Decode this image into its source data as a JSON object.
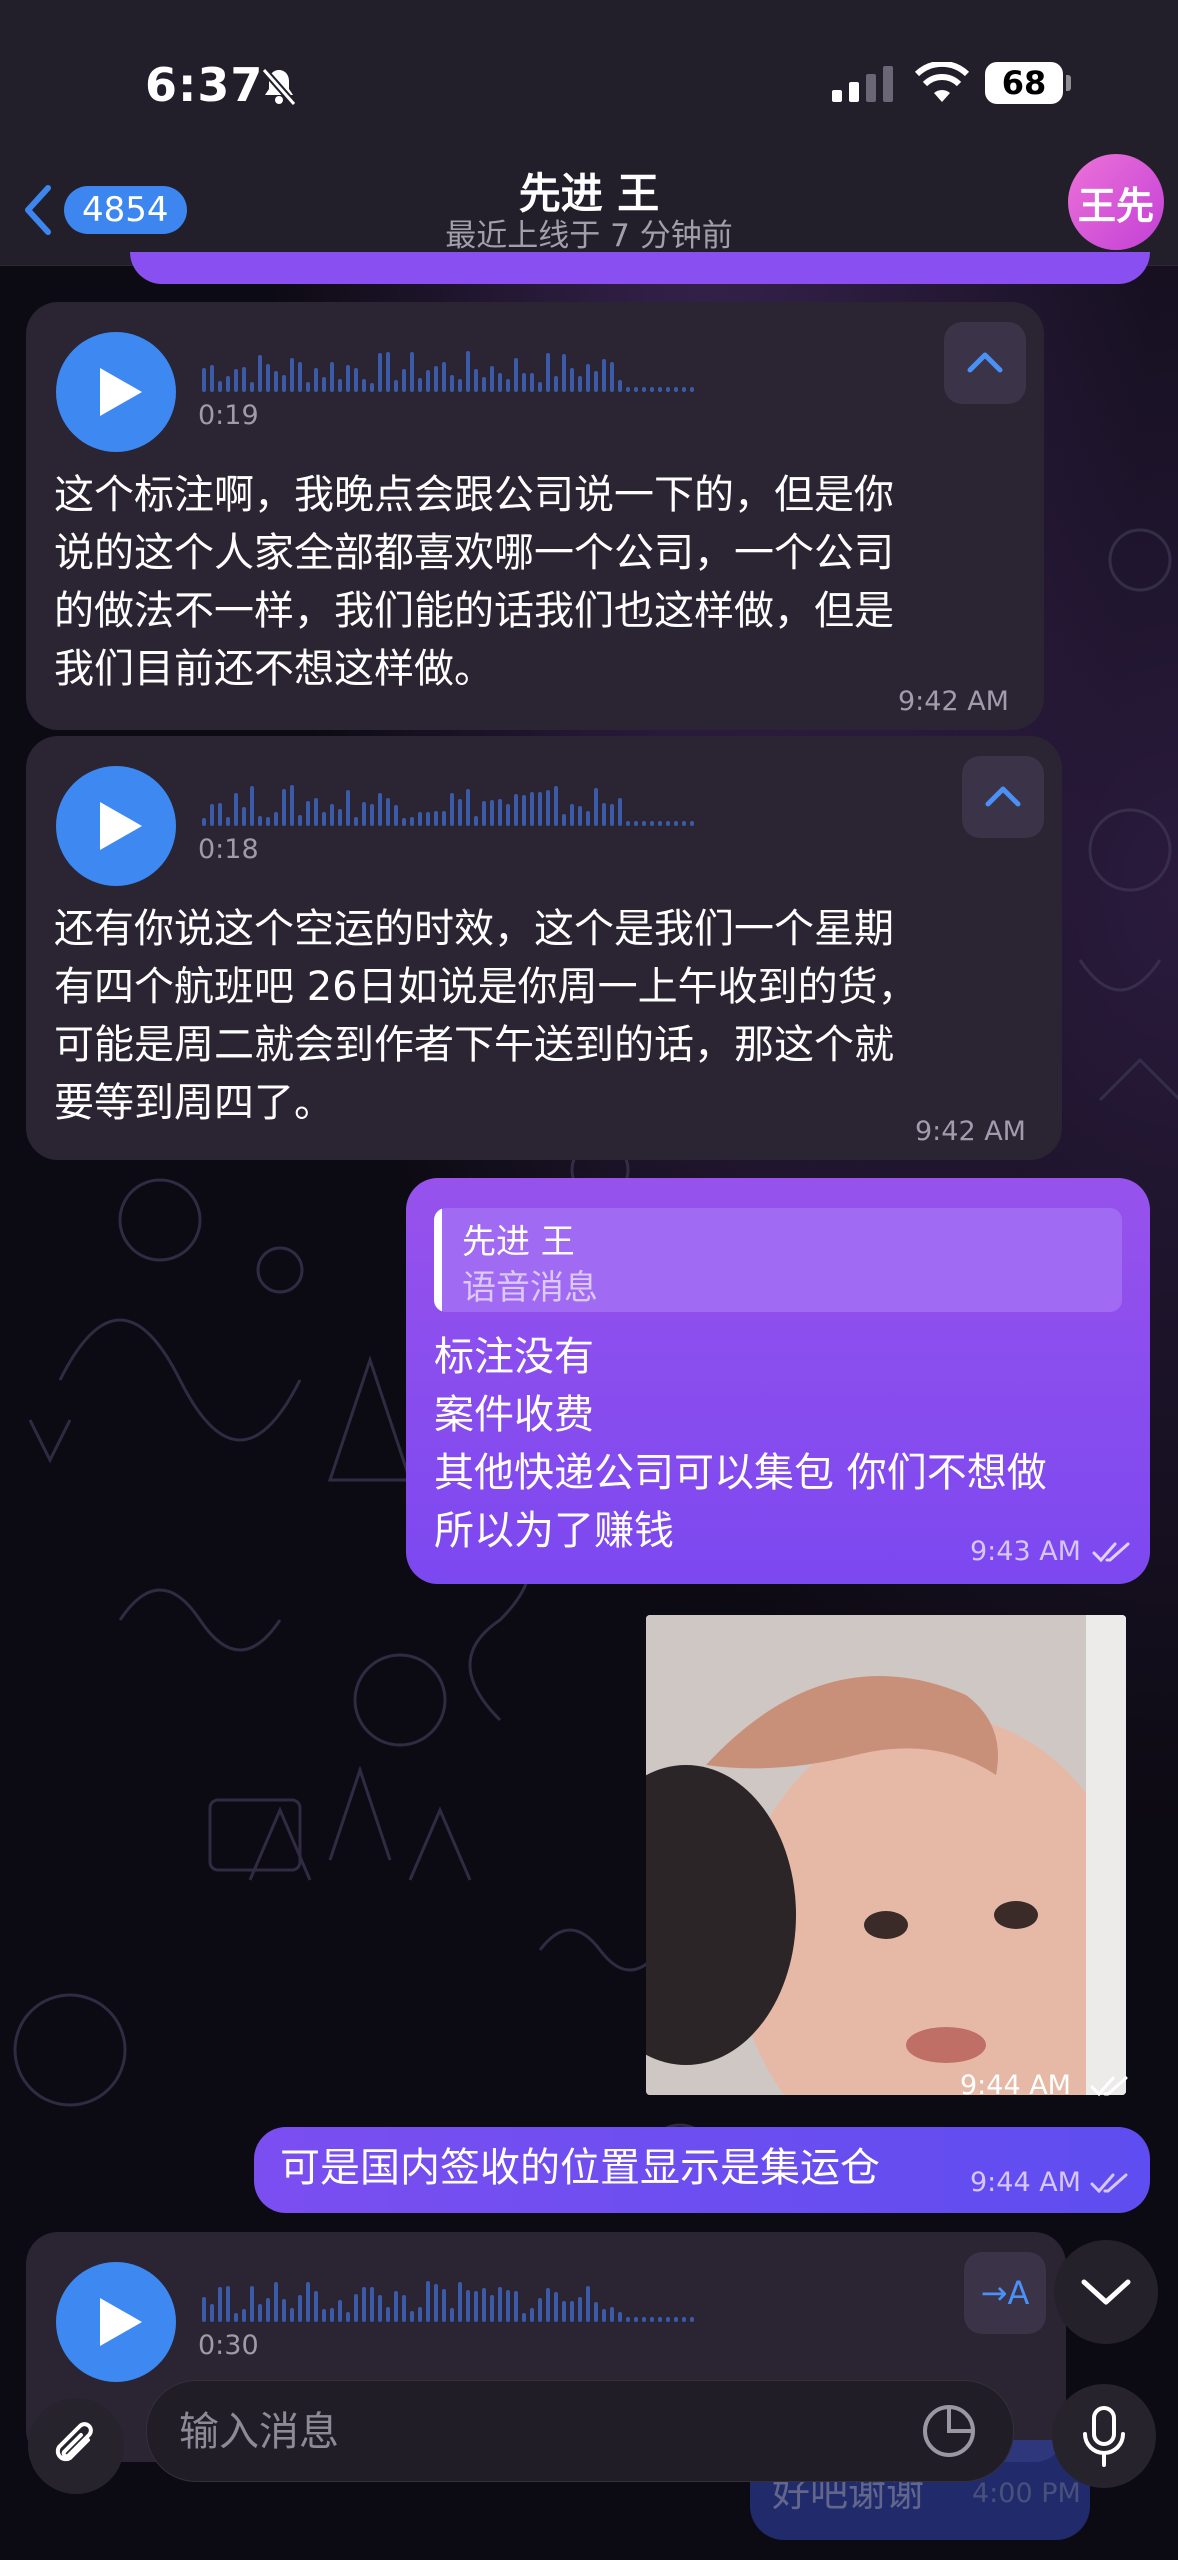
{
  "status": {
    "time": "6:37",
    "battery": "68"
  },
  "header": {
    "back_count": "4854",
    "title": "先进 王",
    "subtitle": "最近上线于 7 分钟前",
    "avatar": "王先"
  },
  "messages": [
    {
      "type": "voice",
      "duration": "0:19",
      "text": "这个标注啊，我晚点会跟公司说一下的，但是你\n说的这个人家全部都喜欢哪一个公司，一个公司\n的做法不一样，我们能的话我们也这样做，但是\n我们目前还不想这样做。",
      "time": "9:42 AM"
    },
    {
      "type": "voice",
      "duration": "0:18",
      "text": "还有你说这个空运的时效，这个是我们一个星期\n有四个航班吧 26日如说是你周一上午收到的货，\n可能是周二就会到作者下午送到的话，那这个就\n要等到周四了。",
      "time": "9:42 AM"
    },
    {
      "type": "reply",
      "reply_name": "先进 王",
      "reply_type": "语音消息",
      "text": "标注没有\n案件收费\n其他快递公司可以集包 你们不想做\n所以为了赚钱",
      "time": "9:43 AM"
    },
    {
      "type": "sticker",
      "time": "9:44 AM"
    },
    {
      "type": "text",
      "text": "可是国内签收的位置显示是集运仓",
      "time": "9:44 AM"
    },
    {
      "type": "voice",
      "duration": "0:30",
      "translate": "→A"
    }
  ],
  "composer": {
    "placeholder": "输入消息"
  },
  "behind": {
    "text": "好吧谢谢",
    "time": "4:00 PM"
  }
}
